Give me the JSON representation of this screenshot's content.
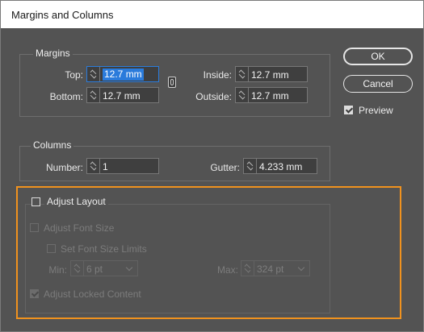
{
  "dialog": {
    "title": "Margins and Columns"
  },
  "margins": {
    "group_label": "Margins",
    "top": {
      "label": "Top:",
      "value": "12.7 mm"
    },
    "bottom": {
      "label": "Bottom:",
      "value": "12.7 mm"
    },
    "inside": {
      "label": "Inside:",
      "value": "12.7 mm"
    },
    "outside": {
      "label": "Outside:",
      "value": "12.7 mm"
    }
  },
  "columns": {
    "group_label": "Columns",
    "number": {
      "label": "Number:",
      "value": "1"
    },
    "gutter": {
      "label": "Gutter:",
      "value": "4.233 mm"
    }
  },
  "buttons": {
    "ok": "OK",
    "cancel": "Cancel"
  },
  "preview": {
    "label": "Preview",
    "checked": true
  },
  "adjust_layout": {
    "label": "Adjust Layout",
    "checked": false,
    "adjust_font_size": {
      "label": "Adjust Font Size",
      "checked": false,
      "enabled": false
    },
    "set_font_size_limits": {
      "label": "Set Font Size Limits",
      "checked": false,
      "enabled": false
    },
    "min": {
      "label": "Min:",
      "value": "6 pt"
    },
    "max": {
      "label": "Max:",
      "value": "324 pt"
    },
    "adjust_locked_content": {
      "label": "Adjust Locked Content",
      "checked": true,
      "enabled": false
    }
  },
  "colors": {
    "dialog_bg": "#535353",
    "highlight": "#f0921e",
    "selection": "#2a7bdb"
  }
}
